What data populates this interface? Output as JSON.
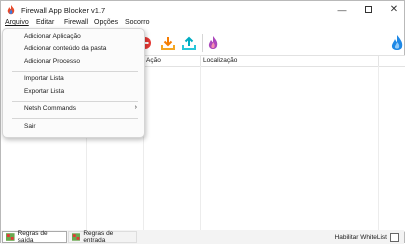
{
  "window": {
    "title": "Firewall App Blocker v1.7"
  },
  "menubar": {
    "items": [
      "Arquivo",
      "Editar",
      "Firewall",
      "Opções",
      "Socorro"
    ]
  },
  "arquivo_menu": {
    "add_app": "Adicionar Aplicação",
    "add_folder": "Adicionar  conteúdo da pasta",
    "add_process": "Adicionar Processo",
    "import_list": "Importar Lista",
    "export_list": "Exportar Lista",
    "netsh": "Netsh Commands",
    "netsh_arrow": "›",
    "exit": "Sair"
  },
  "table": {
    "columns": [
      "Ação",
      "Localização"
    ]
  },
  "status": {
    "tab_out": "Regras de saída",
    "tab_in": "Regras de entrada",
    "whitelist_label": "Habilitar WhiteList"
  },
  "colors": {
    "accent_blue": "#1e88e5",
    "menu_bg": "#fbfbfb"
  },
  "toolbar_icons": [
    "delete-icon",
    "download-arrow-icon",
    "upload-arrow-icon",
    "purple-flame-icon",
    "blue-flame-icon"
  ]
}
